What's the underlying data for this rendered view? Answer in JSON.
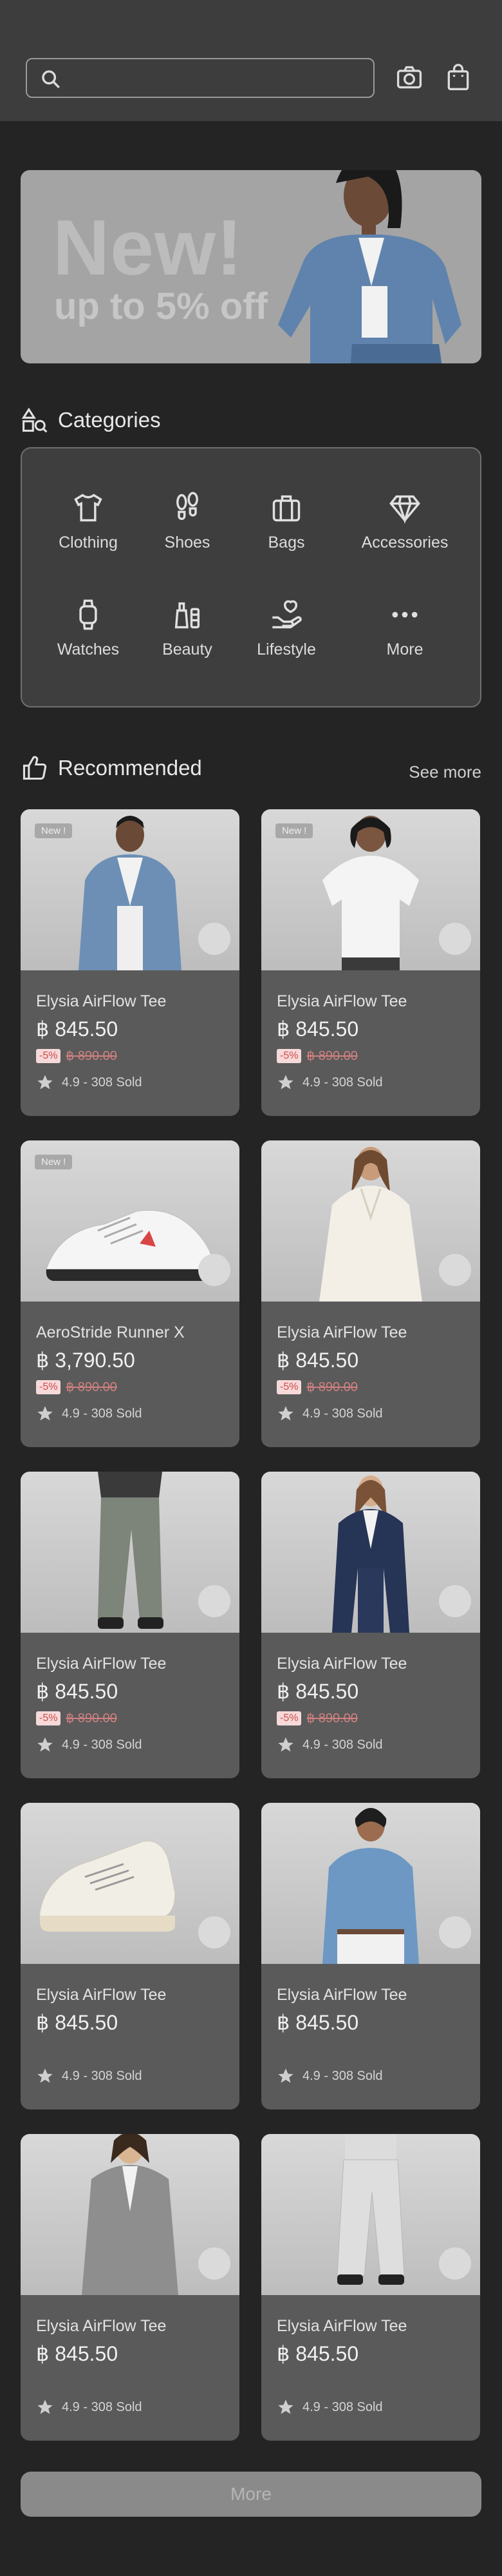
{
  "search": {
    "placeholder": ""
  },
  "banner": {
    "headline": "New!",
    "subline": "up to 5% off"
  },
  "categories": {
    "title": "Categories",
    "items": [
      {
        "label": "Clothing",
        "icon": "shirt-icon"
      },
      {
        "label": "Shoes",
        "icon": "footprints-icon"
      },
      {
        "label": "Bags",
        "icon": "bag-icon"
      },
      {
        "label": "Accessories",
        "icon": "diamond-icon"
      },
      {
        "label": "Watches",
        "icon": "watch-icon"
      },
      {
        "label": "Beauty",
        "icon": "beauty-icon"
      },
      {
        "label": "Lifestyle",
        "icon": "lifestyle-icon"
      },
      {
        "label": "More",
        "icon": "more-dots-icon"
      }
    ]
  },
  "recommended": {
    "title": "Recommended",
    "see_more": "See more"
  },
  "products": [
    {
      "name": "Elysia AirFlow Tee",
      "price": "฿ 845.50",
      "discount": "-5%",
      "old_price": "฿ 890.00",
      "rating": "4.9 - 308 Sold",
      "badge": "New !"
    },
    {
      "name": "Elysia AirFlow Tee",
      "price": "฿ 845.50",
      "discount": "-5%",
      "old_price": "฿ 890.00",
      "rating": "4.9 - 308 Sold",
      "badge": "New !"
    },
    {
      "name": "AeroStride Runner X",
      "price": "฿ 3,790.50",
      "discount": "-5%",
      "old_price": "฿ 890.00",
      "rating": "4.9 - 308 Sold",
      "badge": "New !"
    },
    {
      "name": "Elysia AirFlow Tee",
      "price": "฿ 845.50",
      "discount": "-5%",
      "old_price": "฿ 890.00",
      "rating": "4.9 - 308 Sold",
      "badge": ""
    },
    {
      "name": "Elysia AirFlow Tee",
      "price": "฿ 845.50",
      "discount": "-5%",
      "old_price": "฿ 890.00",
      "rating": "4.9 - 308 Sold",
      "badge": ""
    },
    {
      "name": "Elysia AirFlow Tee",
      "price": "฿ 845.50",
      "discount": "-5%",
      "old_price": "฿ 890.00",
      "rating": "4.9 - 308 Sold",
      "badge": ""
    },
    {
      "name": "Elysia AirFlow Tee",
      "price": "฿ 845.50",
      "discount": "",
      "old_price": "",
      "rating": "4.9 - 308 Sold",
      "badge": ""
    },
    {
      "name": "Elysia AirFlow Tee",
      "price": "฿ 845.50",
      "discount": "",
      "old_price": "",
      "rating": "4.9 - 308 Sold",
      "badge": ""
    },
    {
      "name": "Elysia AirFlow Tee",
      "price": "฿ 845.50",
      "discount": "",
      "old_price": "",
      "rating": "4.9 - 308 Sold",
      "badge": ""
    },
    {
      "name": "Elysia AirFlow Tee",
      "price": "฿ 845.50",
      "discount": "",
      "old_price": "",
      "rating": "4.9 - 308 Sold",
      "badge": ""
    }
  ],
  "more_button": "More",
  "colors": {
    "background": "#242424",
    "header": "#3d3d3d",
    "card": "#5a5a5a",
    "discount_text": "#d04a4a",
    "discount_bg": "#f6d9d9"
  }
}
